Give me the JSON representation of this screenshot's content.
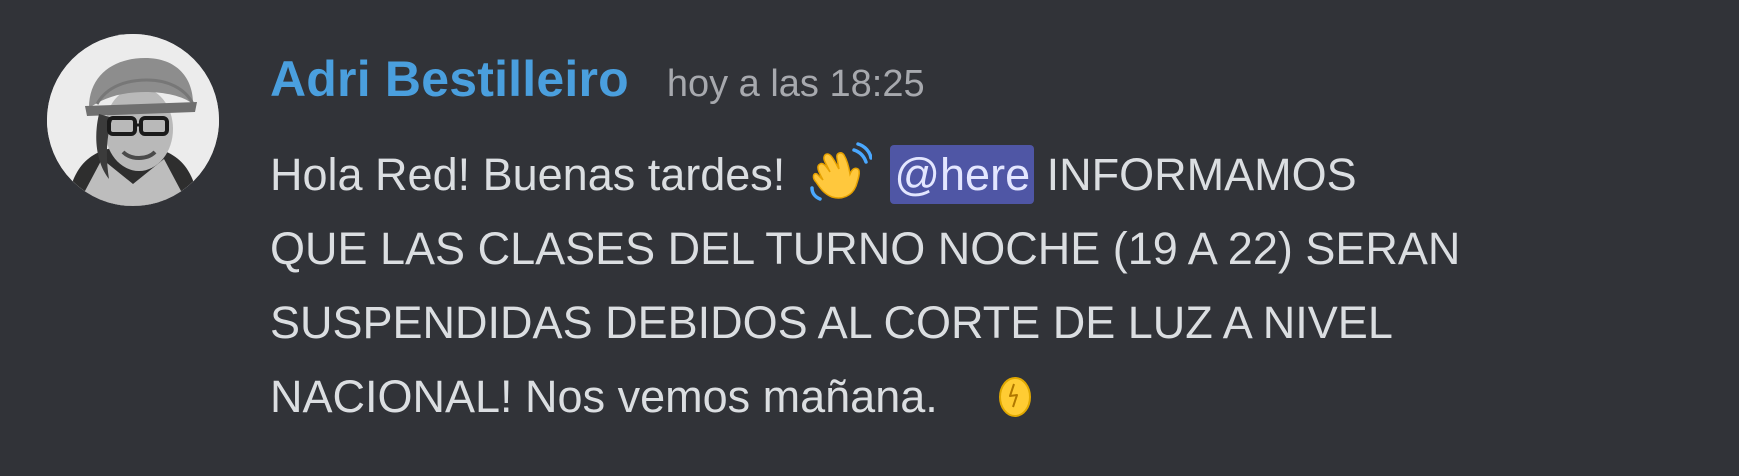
{
  "message": {
    "author": "Adri Bestilleiro",
    "timestamp": "hoy a las 18:25",
    "avatar_icon": "user-avatar-photo",
    "line1_before": "Hola Red! Buenas tardes!",
    "line1_emoji": "waving-hand-emoji",
    "mention": "@here",
    "line1_after": "INFORMAMOS",
    "line2": "QUE LAS CLASES DEL TURNO NOCHE (19 A 22) SERAN",
    "line3": "SUSPENDIDAS DEBIDOS AL CORTE DE LUZ A NIVEL",
    "line4": "NACIONAL! Nos vemos mañana.",
    "line4_emoji": "egg-emoji"
  },
  "colors": {
    "background": "#313338",
    "username": "#4a9fde",
    "timestamp": "#a7a9ae",
    "text": "#dbdee1",
    "mention_bg": "#4f56a5"
  }
}
